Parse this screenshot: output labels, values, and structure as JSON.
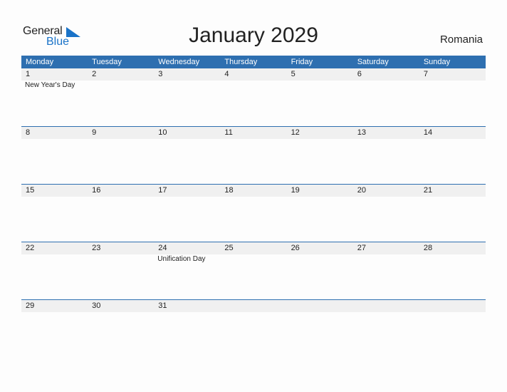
{
  "logo": {
    "word1": "General",
    "word2": "Blue"
  },
  "title": "January 2029",
  "country": "Romania",
  "weekdays": [
    "Monday",
    "Tuesday",
    "Wednesday",
    "Thursday",
    "Friday",
    "Saturday",
    "Sunday"
  ],
  "weeks": [
    {
      "days": [
        "1",
        "2",
        "3",
        "4",
        "5",
        "6",
        "7"
      ],
      "events": [
        "New Year's Day",
        "",
        "",
        "",
        "",
        "",
        ""
      ]
    },
    {
      "days": [
        "8",
        "9",
        "10",
        "11",
        "12",
        "13",
        "14"
      ],
      "events": [
        "",
        "",
        "",
        "",
        "",
        "",
        ""
      ]
    },
    {
      "days": [
        "15",
        "16",
        "17",
        "18",
        "19",
        "20",
        "21"
      ],
      "events": [
        "",
        "",
        "",
        "",
        "",
        "",
        ""
      ]
    },
    {
      "days": [
        "22",
        "23",
        "24",
        "25",
        "26",
        "27",
        "28"
      ],
      "events": [
        "",
        "",
        "Unification Day",
        "",
        "",
        "",
        ""
      ]
    },
    {
      "days": [
        "29",
        "30",
        "31",
        "",
        "",
        "",
        ""
      ],
      "events": [
        "",
        "",
        "",
        "",
        "",
        "",
        ""
      ]
    }
  ],
  "colors": {
    "accent": "#2e6fb0",
    "daybar": "#f0f0f0",
    "logo_blue": "#1a73c8"
  }
}
